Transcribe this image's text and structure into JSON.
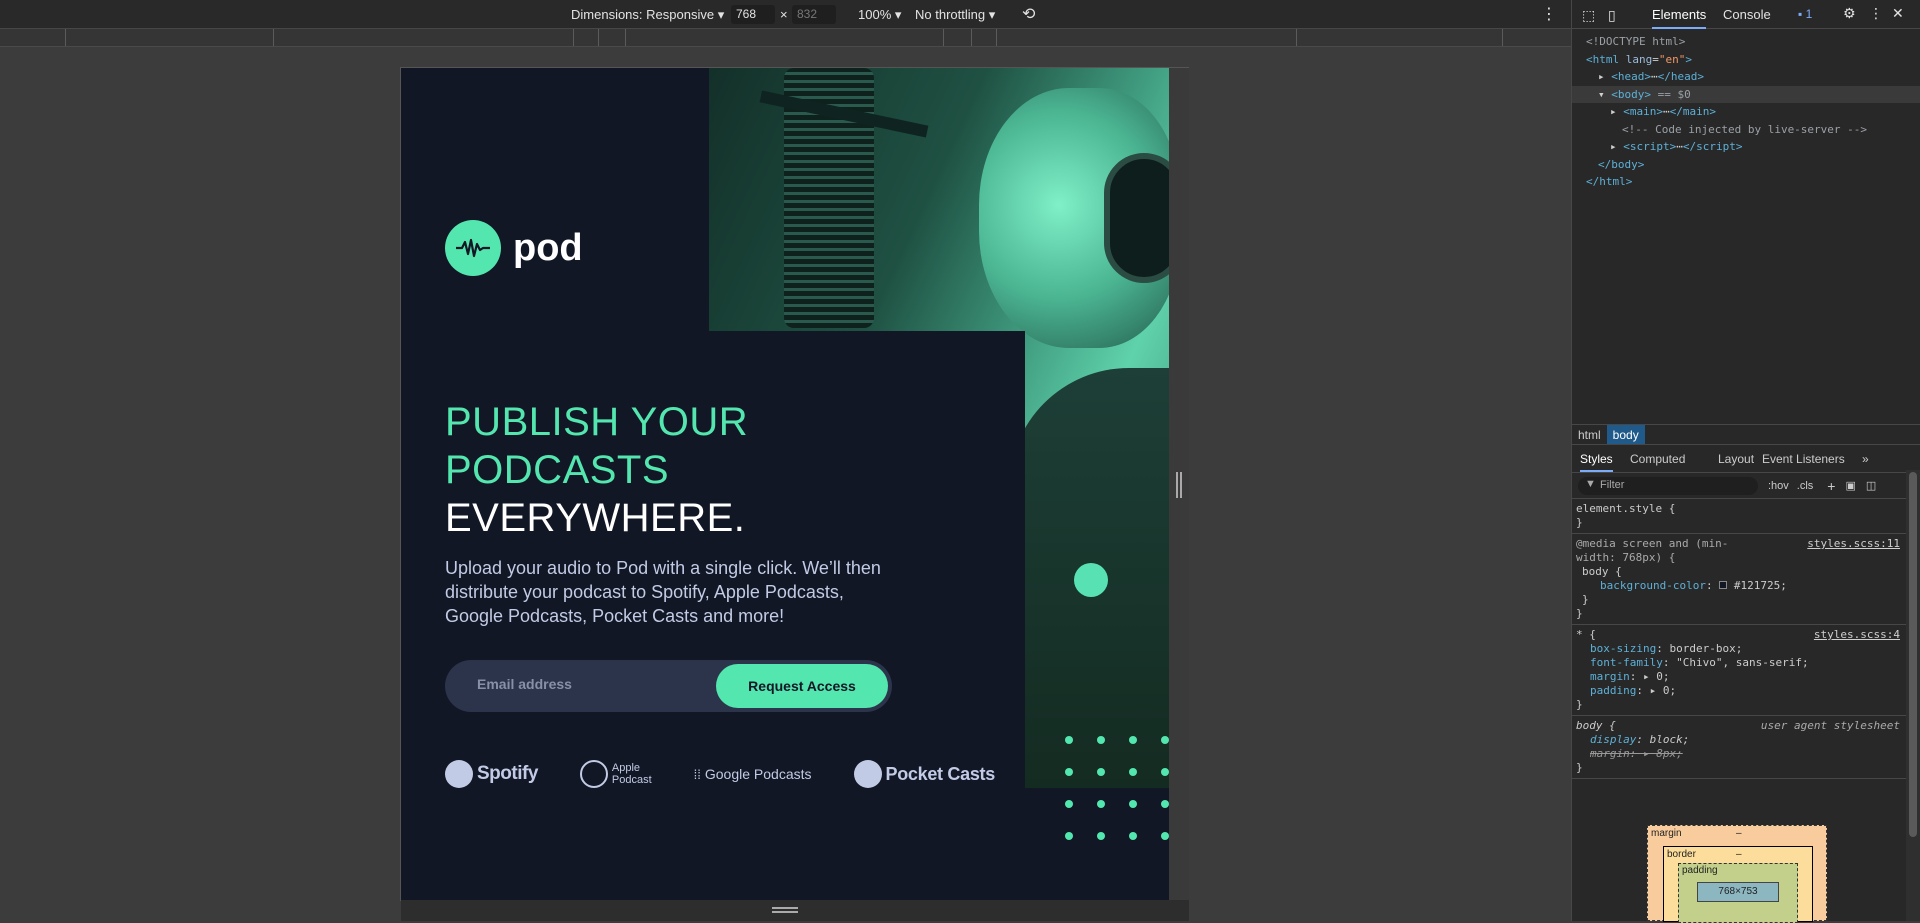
{
  "toolbar": {
    "dimensions_label": "Dimensions: Responsive",
    "width_value": "768",
    "times": "×",
    "height_value": "832",
    "zoom": "100%",
    "throttling": "No throttling"
  },
  "page": {
    "logo_text": "pod",
    "headline_line1": "PUBLISH YOUR",
    "headline_line2": "PODCASTS",
    "headline_line3": "EVERYWHERE.",
    "description": "Upload your audio to Pod with a single click. We’ll then distribute your podcast to Spotify, Apple Podcasts, Google Podcasts, Pocket Casts and more!",
    "email_placeholder": "Email address",
    "cta_label": "Request Access",
    "platforms": {
      "spotify": "Spotify",
      "apple_line1": "Apple",
      "apple_line2": "Podcast",
      "google": "Google Podcasts",
      "pocket": "Pocket Casts"
    },
    "colors": {
      "background": "#121725",
      "accent": "#54e6af",
      "text": "#c2cbe5"
    }
  },
  "devtools": {
    "tab_elements": "Elements",
    "tab_console": "Console",
    "issues_count": "1",
    "dom": {
      "doctype": "<!DOCTYPE html>",
      "html_open_tag": "html",
      "html_attr_name": "lang",
      "html_attr_value": "\"en\"",
      "head": "head",
      "body": "body",
      "body_ref": "== $0",
      "main": "main",
      "comment": "<!-- Code injected by live-server -->",
      "script": "script",
      "body_close": "</body>",
      "html_close": "</html>"
    },
    "breadcrumb": [
      "html",
      "body"
    ],
    "subtabs": [
      "Styles",
      "Computed",
      "Layout",
      "Event Listeners"
    ],
    "filter_placeholder": "Filter",
    "hov": ":hov",
    "cls": ".cls",
    "styles": {
      "element_style": "element.style {",
      "close": "}",
      "media_query": "@media screen and (min-width: 768px) {",
      "media_source": "styles.scss:11",
      "body_selector": "body {",
      "bg_prop": "background-color",
      "bg_value": "#121725;",
      "universal_selector": "* {",
      "universal_source": "styles.scss:4",
      "box_sizing_prop": "box-sizing",
      "box_sizing_value": "border-box;",
      "font_family_prop": "font-family",
      "font_family_value": "\"Chivo\", sans-serif;",
      "margin_prop": "margin",
      "margin_value": "▸ 0;",
      "padding_prop": "padding",
      "padding_value": "▸ 0;",
      "ua_selector": "body {",
      "ua_source": "user agent stylesheet",
      "display_prop": "display",
      "display_value": "block;",
      "ua_margin_prop": "margin",
      "ua_margin_value": "▸ 8px;"
    },
    "box_model": {
      "margin_label": "margin",
      "border_label": "border",
      "padding_label": "padding",
      "dash": "–",
      "content_size": "768×753"
    }
  }
}
